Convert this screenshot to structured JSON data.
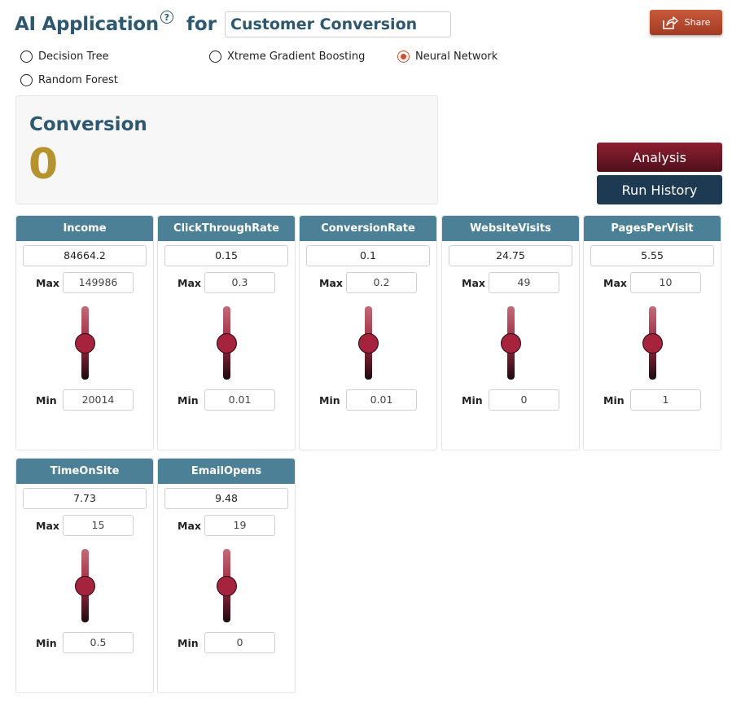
{
  "header": {
    "app_title": "AI Application",
    "help_glyph": "?",
    "for_word": "for",
    "title_value": "Customer Conversion",
    "share_label": "Share",
    "share_icon": "share-icon"
  },
  "models": [
    {
      "label": "Decision Tree",
      "selected": false
    },
    {
      "label": "Xtreme Gradient Boosting",
      "selected": false
    },
    {
      "label": "Neural Network",
      "selected": true
    },
    {
      "label": "Random Forest",
      "selected": false
    }
  ],
  "result": {
    "label": "Conversion",
    "value": "0"
  },
  "buttons": {
    "analysis": "Analysis",
    "run_history": "Run History"
  },
  "labels": {
    "max": "Max",
    "min": "Min"
  },
  "features": [
    {
      "name": "Income",
      "value": "84664.2",
      "max": "149986",
      "min": "20014"
    },
    {
      "name": "ClickThroughRate",
      "value": "0.15",
      "max": "0.3",
      "min": "0.01"
    },
    {
      "name": "ConversionRate",
      "value": "0.1",
      "max": "0.2",
      "min": "0.01"
    },
    {
      "name": "WebsiteVisits",
      "value": "24.75",
      "max": "49",
      "min": "0"
    },
    {
      "name": "PagesPerVisit",
      "value": "5.55",
      "max": "10",
      "min": "1"
    },
    {
      "name": "TimeOnSite",
      "value": "7.73",
      "max": "15",
      "min": "0.5"
    },
    {
      "name": "EmailOpens",
      "value": "9.48",
      "max": "19",
      "min": "0"
    }
  ],
  "colors": {
    "title": "#2e5770",
    "card_header": "#4c8096",
    "result_value": "#b5932f",
    "analysis_button": "#7a1a2c",
    "history_button": "#1e3a52",
    "share_button": "#b8492d",
    "radio_selected": "#d64a2d"
  }
}
